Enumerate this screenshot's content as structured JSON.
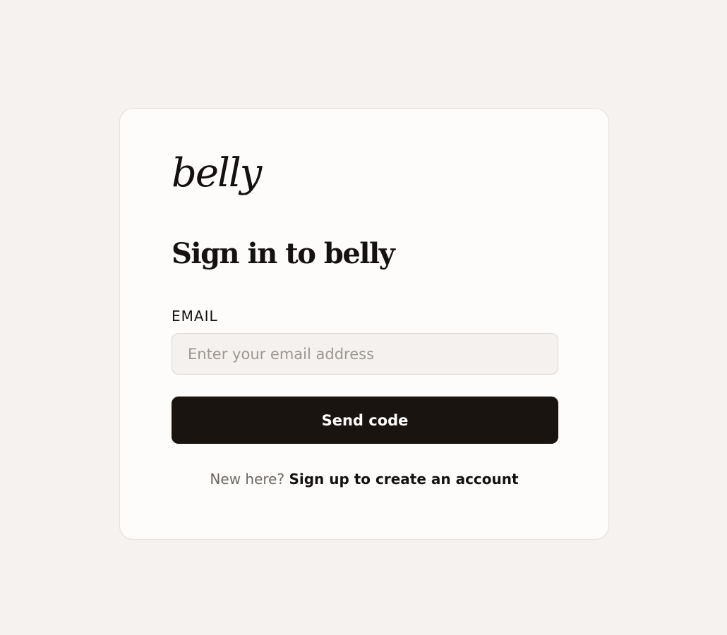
{
  "brand": {
    "logo_text": "belly"
  },
  "signin": {
    "title": "Sign in to belly",
    "email_label": "EMAIL",
    "email_placeholder": "Enter your email address",
    "email_value": "",
    "send_button_label": "Send code",
    "new_here_text": "New here?",
    "signup_link_label": "Sign up to create an account"
  },
  "colors": {
    "page_background": "#f5f2ef",
    "card_background": "#fdfcfa",
    "primary_button": "#191410",
    "input_background": "#f4f1ee"
  }
}
